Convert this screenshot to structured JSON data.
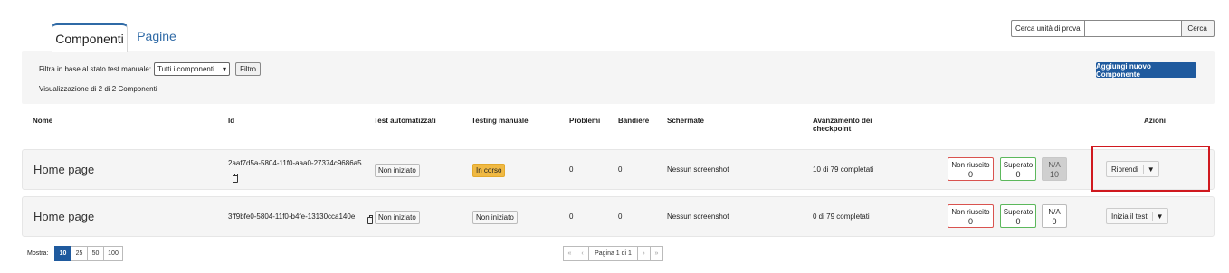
{
  "tabs": {
    "active": "Componenti",
    "inactive": "Pagine"
  },
  "search": {
    "label": "Cerca unità di prova",
    "value": "",
    "button": "Cerca"
  },
  "filter": {
    "label": "Filtra in base al stato test manuale:",
    "selected": "Tutti i componenti",
    "button": "Filtro",
    "showing": "Visualizzazione di 2 di 2 Componenti"
  },
  "add_button": "Aggiungi nuovo Componente",
  "headers": {
    "name": "Nome",
    "id": "Id",
    "auto": "Test automatizzati",
    "manual": "Testing manuale",
    "problems": "Problemi",
    "flags": "Bandiere",
    "screens": "Schermate",
    "progress_1": "Avanzamento dei",
    "progress_2": "checkpoint",
    "actions": "Azioni"
  },
  "rows": [
    {
      "name": "Home page",
      "id": "2aaf7d5a-5804-11f0-aaa0-27374c9686a5",
      "auto": "Non iniziato",
      "manual": "In corso",
      "problems": "0",
      "flags": "0",
      "screens": "Nessun screenshot",
      "progress": "10 di 79 completati",
      "fail_label": "Non riuscito",
      "fail": "0",
      "pass_label": "Superato",
      "pass": "0",
      "na_label": "N/A",
      "na": "10",
      "action": "Riprendi"
    },
    {
      "name": "Home page",
      "id": "3ff9bfe0-5804-11f0-b4fe-13130cca140e",
      "auto": "Non iniziato",
      "manual": "Non iniziato",
      "problems": "0",
      "flags": "0",
      "screens": "Nessun screenshot",
      "progress": "0 di 79 completati",
      "fail_label": "Non riuscito",
      "fail": "0",
      "pass_label": "Superato",
      "pass": "0",
      "na_label": "N/A",
      "na": "0",
      "action": "Inizia il test"
    }
  ],
  "pagination": {
    "show_label": "Mostra:",
    "sizes": [
      "10",
      "25",
      "50",
      "100"
    ],
    "first": "«",
    "prev": "‹",
    "page_label": "Pagina 1 di 1",
    "next": "›",
    "last": "»"
  },
  "colors": {
    "accent": "#1f5a9e",
    "highlight": "#d0191f",
    "in_progress": "#f0b943"
  }
}
